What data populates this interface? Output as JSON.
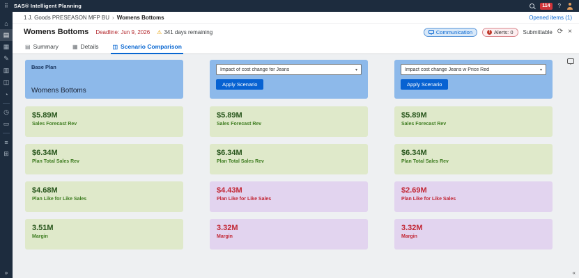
{
  "topbar": {
    "app_title": "SAS® Intelligent Planning",
    "apps_glyph": "⠿",
    "badge_count": "114",
    "help_label": "?"
  },
  "sidebar": {
    "icons": [
      {
        "name": "home",
        "glyph": "⌂"
      },
      {
        "name": "plans",
        "glyph": "▤"
      },
      {
        "name": "grid",
        "glyph": "▦"
      },
      {
        "name": "edit",
        "glyph": "✎"
      },
      {
        "name": "report",
        "glyph": "▥"
      },
      {
        "name": "chart",
        "glyph": "◫"
      },
      {
        "name": "gauge",
        "glyph": "◔"
      },
      {
        "name": "history",
        "glyph": "◷"
      },
      {
        "name": "folder",
        "glyph": "▭"
      },
      {
        "name": "layers",
        "glyph": "≡"
      },
      {
        "name": "briefcase",
        "glyph": "⊞"
      }
    ],
    "expand_glyph": "»"
  },
  "breadcrumb": {
    "path": "1 J. Goods PRESEASON MFP BU",
    "separator": "›",
    "current": "Womens Bottoms",
    "opened_items": "Opened items (1)"
  },
  "header": {
    "title": "Womens Bottoms",
    "deadline": "Deadline: Jun 9, 2026",
    "warning_glyph": "⚠",
    "days_remaining": "341 days remaining",
    "communication": "Communication",
    "alerts": "Alerts: 0",
    "alert_badge": "!",
    "submittable": "Submittable",
    "refresh_glyph": "⟳",
    "close_glyph": "×"
  },
  "tabs": [
    {
      "label": "Summary",
      "glyph": "▤"
    },
    {
      "label": "Details",
      "glyph": "▦"
    },
    {
      "label": "Scenario Comparison",
      "glyph": "◫"
    }
  ],
  "panel": {
    "collapse_glyph": "«"
  },
  "columns": [
    {
      "header_title": "Base Plan",
      "header_subtitle": "Womens Bottoms",
      "metrics": [
        {
          "value": "$5.89M",
          "label": "Sales Forecast Rev",
          "variant": "green"
        },
        {
          "value": "$6.34M",
          "label": "Plan Total Sales Rev",
          "variant": "green"
        },
        {
          "value": "$4.68M",
          "label": "Plan Like for Like Sales",
          "variant": "green"
        },
        {
          "value": "3.51M",
          "label": "Margin",
          "variant": "green"
        }
      ]
    },
    {
      "dropdown_value": "Impact of cost change for Jeans",
      "dropdown_glyph": "▾",
      "apply_label": "Apply Scenario",
      "metrics": [
        {
          "value": "$5.89M",
          "label": "Sales Forecast Rev",
          "variant": "green"
        },
        {
          "value": "$6.34M",
          "label": "Plan Total Sales Rev",
          "variant": "green"
        },
        {
          "value": "$4.43M",
          "label": "Plan Like for Like Sales",
          "variant": "purple"
        },
        {
          "value": "3.32M",
          "label": "Margin",
          "variant": "purple"
        }
      ]
    },
    {
      "dropdown_value": "Impact cost change Jeans w Price Red",
      "dropdown_glyph": "▾",
      "apply_label": "Apply Scenario",
      "metrics": [
        {
          "value": "$5.89M",
          "label": "Sales Forecast Rev",
          "variant": "green"
        },
        {
          "value": "$6.34M",
          "label": "Plan Total Sales Rev",
          "variant": "green"
        },
        {
          "value": "$2.69M",
          "label": "Plan Like for Like Sales",
          "variant": "purple"
        },
        {
          "value": "3.32M",
          "label": "Margin",
          "variant": "purple"
        }
      ]
    }
  ],
  "colors": {
    "topbar_bg": "#1d2c3e",
    "accent": "#0766d1",
    "column_header_bg": "#8db9ea",
    "metric_green_bg": "#dfe9ca",
    "metric_purple_bg": "#e2d4ef",
    "alert_red": "#c0392b",
    "deadline_red": "#b3282d"
  }
}
